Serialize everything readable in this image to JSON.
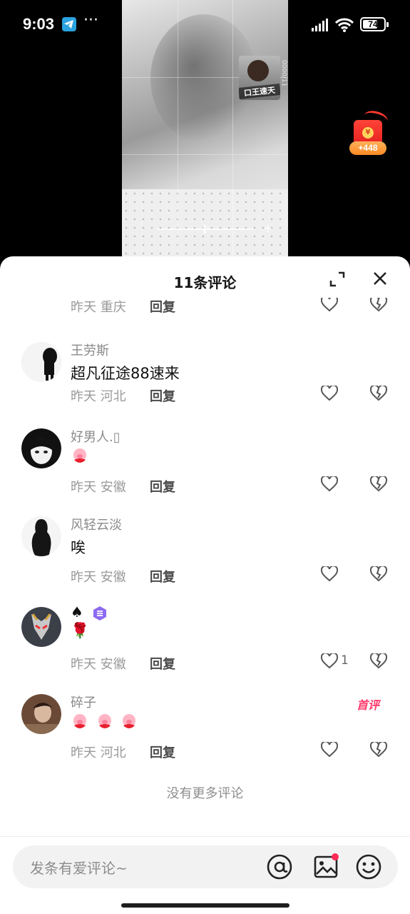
{
  "status_bar": {
    "time": "9:03",
    "more": "···",
    "battery": "74",
    "battery_level_pct": 74,
    "icons": [
      "telegram-icon",
      "signal-icon",
      "wifi-icon",
      "battery-icon"
    ]
  },
  "video": {
    "pip_caption": "口王速天",
    "side_text": "0000/11"
  },
  "red_packet": {
    "coin": "¥",
    "amount": "+448"
  },
  "comments_panel": {
    "title": "11条评论",
    "no_more": "没有更多评论"
  },
  "comments": [
    {
      "user": "",
      "text": "",
      "date": "昨天",
      "location": "重庆",
      "reply": "回复",
      "likes": ""
    },
    {
      "user": "王劳斯",
      "text": "超凡征途88速来",
      "date": "昨天",
      "location": "河北",
      "reply": "回复",
      "likes": ""
    },
    {
      "user": "好男人.▯",
      "text": "",
      "emojis": 1,
      "date": "昨天",
      "location": "安徽",
      "reply": "回复",
      "likes": ""
    },
    {
      "user": "风轻云淡",
      "text": "唉",
      "date": "昨天",
      "location": "安徽",
      "reply": "回复",
      "likes": ""
    },
    {
      "user": "♠",
      "text": "🌹",
      "date": "昨天",
      "location": "安徽",
      "reply": "回复",
      "likes": "1"
    },
    {
      "user": "碎子",
      "badge": "首评",
      "text": "",
      "emojis": 3,
      "date": "昨天",
      "location": "河北",
      "reply": "回复",
      "likes": ""
    }
  ],
  "input": {
    "placeholder": "发条有爱评论~"
  },
  "colors": {
    "accent_pink": "#ff3b6b",
    "telegram_blue": "#2aa3e0",
    "red_packet": "#e51f1f"
  }
}
